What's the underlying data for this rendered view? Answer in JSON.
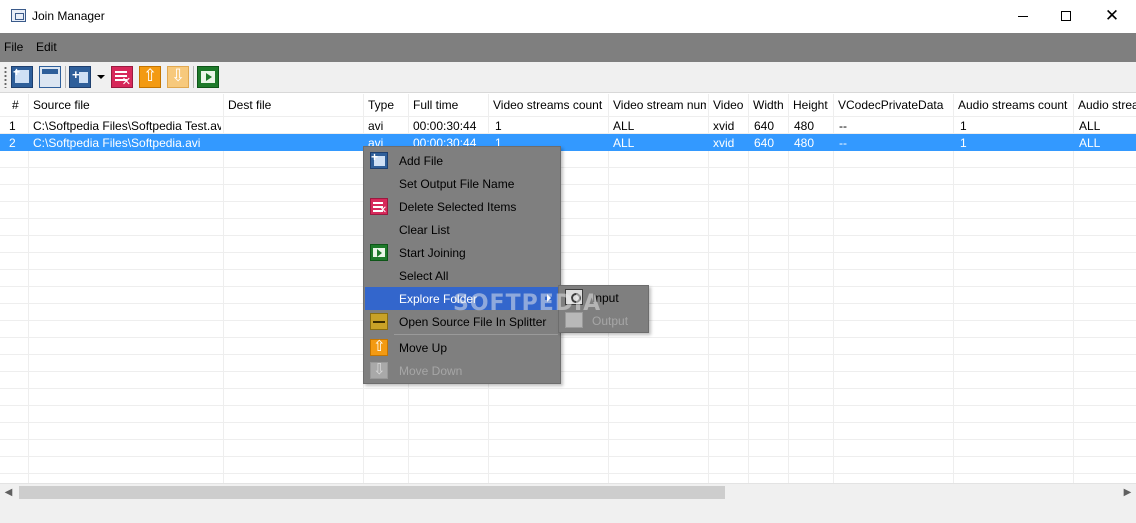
{
  "window": {
    "title": "Join Manager"
  },
  "menu": {
    "file": "File",
    "edit": "Edit"
  },
  "toolbar": {
    "icons": [
      "add-file-icon",
      "set-output-name-icon",
      "add-files-icon",
      "dropdown-arrow-icon",
      "delete-items-icon",
      "move-up-icon",
      "move-down-icon",
      "start-joining-icon"
    ]
  },
  "table": {
    "columns": [
      "#",
      "Source file",
      "Dest file",
      "Type",
      "Full time",
      "Video streams count",
      "Video stream num",
      "Video",
      "Width",
      "Height",
      "VCodecPrivateData",
      "Audio streams count",
      "Audio strea"
    ],
    "rows": [
      [
        "1",
        "C:\\Softpedia Files\\Softpedia Test.avi",
        "",
        "avi",
        "00:00:30:44",
        "1",
        "ALL",
        "xvid",
        "640",
        "480",
        "--",
        "1",
        "ALL"
      ],
      [
        "2",
        "C:\\Softpedia Files\\Softpedia.avi",
        "",
        "avi",
        "00:00:30:44",
        "1",
        "ALL",
        "xvid",
        "640",
        "480",
        "--",
        "1",
        "ALL"
      ]
    ],
    "selected_row": 2
  },
  "context_menu": {
    "items": [
      {
        "label": "Add File",
        "icon": "add-file-icon"
      },
      {
        "label": "Set Output File Name",
        "icon": ""
      },
      {
        "label": "Delete Selected Items",
        "icon": "delete-items-icon"
      },
      {
        "label": "Clear List",
        "icon": ""
      },
      {
        "label": "Start Joining",
        "icon": "start-joining-icon"
      },
      {
        "label": "Select All",
        "icon": ""
      },
      {
        "label": "Explore Folder",
        "icon": "",
        "highlighted": true,
        "has_submenu": true
      },
      {
        "label": "Open Source File In Splitter",
        "icon": "splitter-icon"
      },
      {
        "label": "Move Up",
        "icon": "move-up-icon"
      },
      {
        "label": "Move Down",
        "icon": "move-down-icon",
        "disabled": true
      }
    ],
    "submenu": [
      {
        "label": "Input",
        "icon": "folder-search-icon"
      },
      {
        "label": "Output",
        "icon": "folder-search-icon",
        "disabled": true
      }
    ]
  },
  "watermark": "SOFTPEDIA",
  "colors": {
    "menubar": "#7f7f7f",
    "selection": "#3399ff",
    "menu_highlight": "#3366cc"
  }
}
